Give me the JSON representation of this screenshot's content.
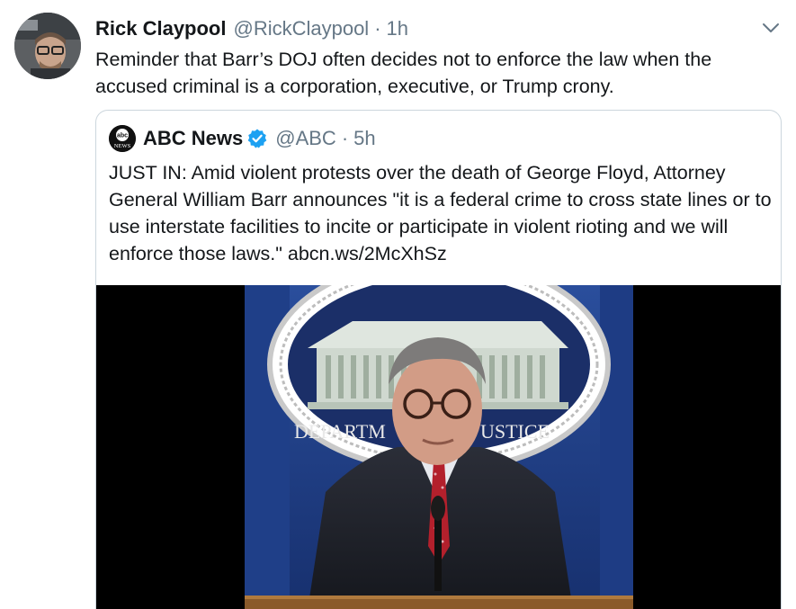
{
  "tweet": {
    "display_name": "Rick Claypool",
    "handle": "@RickClaypool",
    "separator": "·",
    "time": "1h",
    "text": "Reminder that Barr’s DOJ often decides not to enforce the law when the accused criminal is a corporation, executive, or Trump crony."
  },
  "quoted_tweet": {
    "display_name": "ABC News",
    "handle": "@ABC",
    "separator": "·",
    "time": "5h",
    "text": "JUST IN: Amid violent protests over the death of George Floyd, Attorney General William Barr announces \"it is a federal crime to cross state lines or to use interstate facilities to incite or participate in violent rioting and we will enforce those laws.\"",
    "link": "abcn.ws/2McXhSz",
    "logo_text": "abc",
    "logo_subtext": "NEWS"
  },
  "media": {
    "seal_text_left": "DEPARTM",
    "seal_text_right": "USTICE"
  },
  "colors": {
    "primary_text": "#14171a",
    "secondary_text": "#657786",
    "border": "#ccd6dd",
    "verified": "#1da1f2"
  },
  "icons": {
    "caret": "chevron-down-icon",
    "verified": "verified-badge-icon"
  }
}
